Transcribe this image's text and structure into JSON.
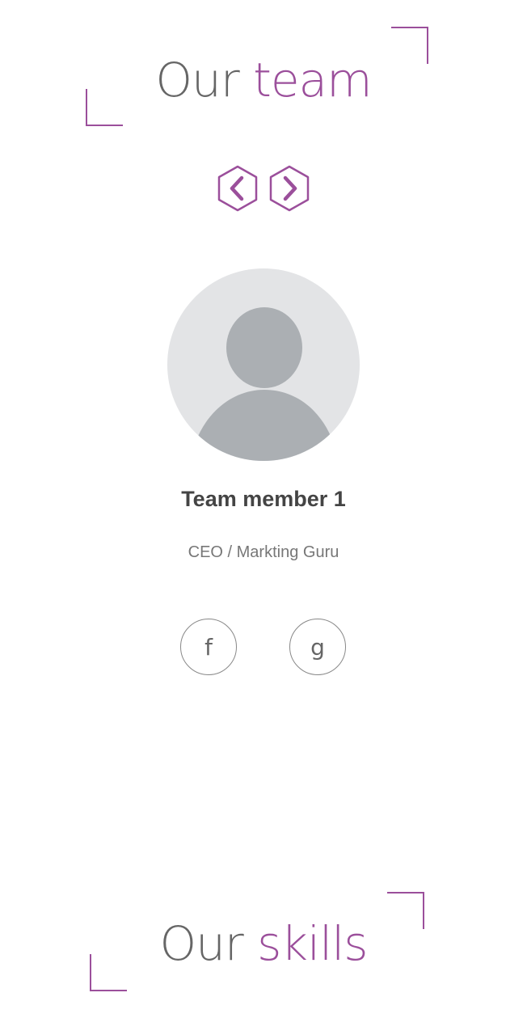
{
  "team_section": {
    "heading_part1": "Our",
    "heading_part2": "team",
    "prev_icon": "chevron-left-hexagon-icon",
    "next_icon": "chevron-right-hexagon-icon"
  },
  "member": {
    "avatar_icon": "user-placeholder-icon",
    "name": "Team member 1",
    "role": "CEO / Markting Guru",
    "social": [
      {
        "icon": "facebook-icon",
        "label": "f"
      },
      {
        "icon": "google-icon",
        "label": "g"
      }
    ]
  },
  "skills_section": {
    "heading_part1": "Our",
    "heading_part2": "skills"
  },
  "colors": {
    "accent": "#9b4f9b",
    "heading_gray": "#666666",
    "avatar_bg": "#e3e4e6",
    "avatar_silhouette": "#abafb3"
  }
}
